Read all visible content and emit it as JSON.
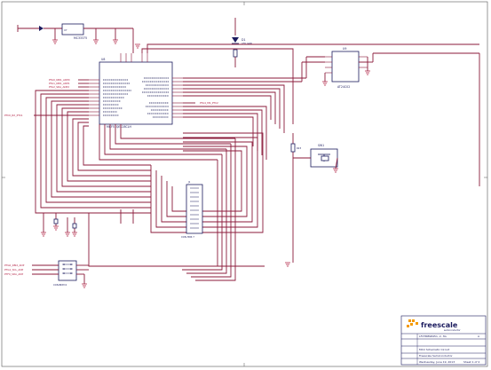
{
  "schematic": {
    "title": "LFXTRBS8451, 2, 3G",
    "subtitle": "MCU Schematic Circuit",
    "company": "freescale",
    "company_tag": "semiconductor"
  },
  "parts": {
    "mcu": {
      "ref": "U8",
      "name": "MCF51QE128CLH"
    },
    "eeprom": {
      "ref": "U9",
      "name": "AT24C02"
    },
    "header": {
      "ref": "J1",
      "name": "CON-HDR 7"
    },
    "bdm": {
      "ref": "J2",
      "name": "CON-BDM 6"
    },
    "led": {
      "ref": "D1",
      "name": "LED GRN"
    },
    "switch": {
      "ref": "SW1",
      "name": "PUSHBUTTON"
    },
    "regulator": {
      "ref": "U7",
      "name": "MC33375"
    }
  },
  "nets": {
    "left_1": "PTA0_KBI1_ADP0",
    "left_2": "PTA1_KBI1_ADP1",
    "left_3": "PTA2_SDA_ADP2",
    "left_4": "PTC0_RX_PTC1",
    "right_1": "PTA4_MS_PTC2",
    "bdm_1": "PTG0_KBI2_ADP",
    "bdm_2": "PTG1_SCL_ADP",
    "bdm_3": "PTF0_SDA_ADP"
  },
  "title_block": {
    "drawn_by": "Freescale Semiconductor",
    "date": "Wednesday, June 19, 2013",
    "sheet": "Sheet 1 of 2",
    "rev": "A"
  }
}
